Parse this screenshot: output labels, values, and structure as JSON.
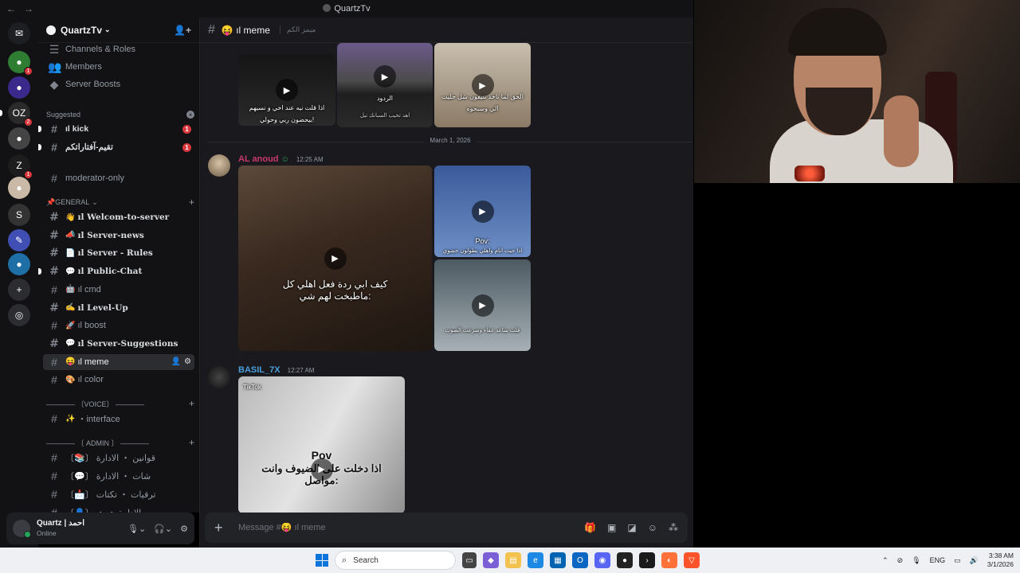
{
  "titlebar": {
    "title": "QuartzTv",
    "back": "←",
    "forward": "→"
  },
  "rail": {
    "servers": [
      {
        "name": "discord-home",
        "color": "#1e1f22",
        "glyph": "✉",
        "badge": ""
      },
      {
        "name": "server-1",
        "color": "#2e7d32",
        "glyph": "●",
        "badge": "1"
      },
      {
        "name": "server-2",
        "color": "#3b2a8c",
        "glyph": "●",
        "badge": ""
      },
      {
        "name": "server-3",
        "color": "#2a2a2a",
        "glyph": "OZ",
        "badge": "2"
      },
      {
        "name": "server-4",
        "color": "#444",
        "glyph": "●",
        "badge": ""
      },
      {
        "name": "server-5",
        "color": "#1d1d1d",
        "glyph": "Z",
        "badge": "1"
      },
      {
        "name": "server-6",
        "color": "#c9b9a6",
        "glyph": "●",
        "badge": ""
      },
      {
        "name": "server-7",
        "color": "#333",
        "glyph": "S",
        "badge": ""
      },
      {
        "name": "server-8",
        "color": "#3f4fb3",
        "glyph": "✎",
        "badge": ""
      },
      {
        "name": "server-9",
        "color": "#1d6fa5",
        "glyph": "●",
        "badge": ""
      },
      {
        "name": "add-server",
        "color": "#2b2d31",
        "glyph": "+",
        "badge": ""
      },
      {
        "name": "discover",
        "color": "#2b2d31",
        "glyph": "◎",
        "badge": ""
      }
    ]
  },
  "sidebar": {
    "server_name": "QuartzTv",
    "top_items": [
      "Channels & Roles",
      "Members",
      "Server Boosts"
    ],
    "suggested_label": "Suggested",
    "suggested": [
      {
        "emoji": "🟢",
        "label": "ıl kick",
        "badge": "1"
      },
      {
        "emoji": "",
        "label": "تقيم-آفتاراتكم",
        "badge": "1"
      }
    ],
    "moderator": "moderator-only",
    "general_label": "📌GENERAL",
    "general": [
      {
        "emoji": "👋",
        "label": "ıl Welcom-to-server",
        "bold": true
      },
      {
        "emoji": "📣",
        "label": "ıl Server-news",
        "bold": true
      },
      {
        "emoji": "📄",
        "label": "ıl Server - Rules",
        "bold": true
      },
      {
        "emoji": "💬",
        "label": "ıl Public-Chat",
        "bold": true
      },
      {
        "emoji": "🤖",
        "label": "ıl cmd",
        "bold": false
      },
      {
        "emoji": "✍️",
        "label": "ıl Level-Up",
        "bold": true
      },
      {
        "emoji": "🚀",
        "label": "ıl boost",
        "bold": false
      },
      {
        "emoji": "💬",
        "label": "ıl Server-Suggestions",
        "bold": true
      },
      {
        "emoji": "😝",
        "label": "ıl meme",
        "bold": false
      },
      {
        "emoji": "🎨",
        "label": "ıl color",
        "bold": false
      }
    ],
    "voice_label": "———— 〔VOICE〕 ————",
    "voice": [
      {
        "emoji": "✨",
        "label": "・interface"
      }
    ],
    "admin_label": "———— 〔 ADMIN 〕 ————",
    "admin": [
      {
        "label": "〔📚〕 قوانين ・ الادارة"
      },
      {
        "label": "〔💬〕 شات ・ الادارة"
      },
      {
        "label": "〔📩〕 ترقيات ・ تكتات"
      },
      {
        "label": "〔👤〕 ・ ・ الادارة"
      }
    ]
  },
  "user": {
    "name": "Quartz | احمد",
    "status": "Online"
  },
  "channel": {
    "name": "ıl meme",
    "emoji": "😝",
    "topic": "ميمز الكم"
  },
  "messages": {
    "date_divider": "March 1, 2026",
    "top_captions": [
      "اذا قلت نيه عند اخي و نسيهم بيحضون ربي وحولي!",
      "الردود",
      "اهد تخيب السبانك تيل",
      "الحق لما تاخذ تليفون شل حليت الي وسبحوه"
    ],
    "msg1": {
      "author": "AL anoud",
      "author_color": "#c9376d",
      "time": "12:25 AM",
      "main_caption": "كيف ابي ردة فعل اهلي كل ماطبخت لهم شي:",
      "side_caption": "Pov:",
      "side_caption2": "اذا جيت انام واهلي يطولون حشوي",
      "side_caption3": "قلت ساعد عفاء وشرعت الصوت"
    },
    "msg2": {
      "author": "BASIL_7X",
      "author_color": "#4a9fdb",
      "time": "12:27 AM",
      "caption_top": "Pov",
      "caption": "اذا دخلت على الضيوف وانت مواصل:",
      "watermark": "TikTok"
    }
  },
  "composer": {
    "placeholder": "Message #😝 ıl meme"
  },
  "taskbar": {
    "search": "Search",
    "lang": "ENG",
    "time": "3:38 AM",
    "date": "3/1/2026"
  }
}
